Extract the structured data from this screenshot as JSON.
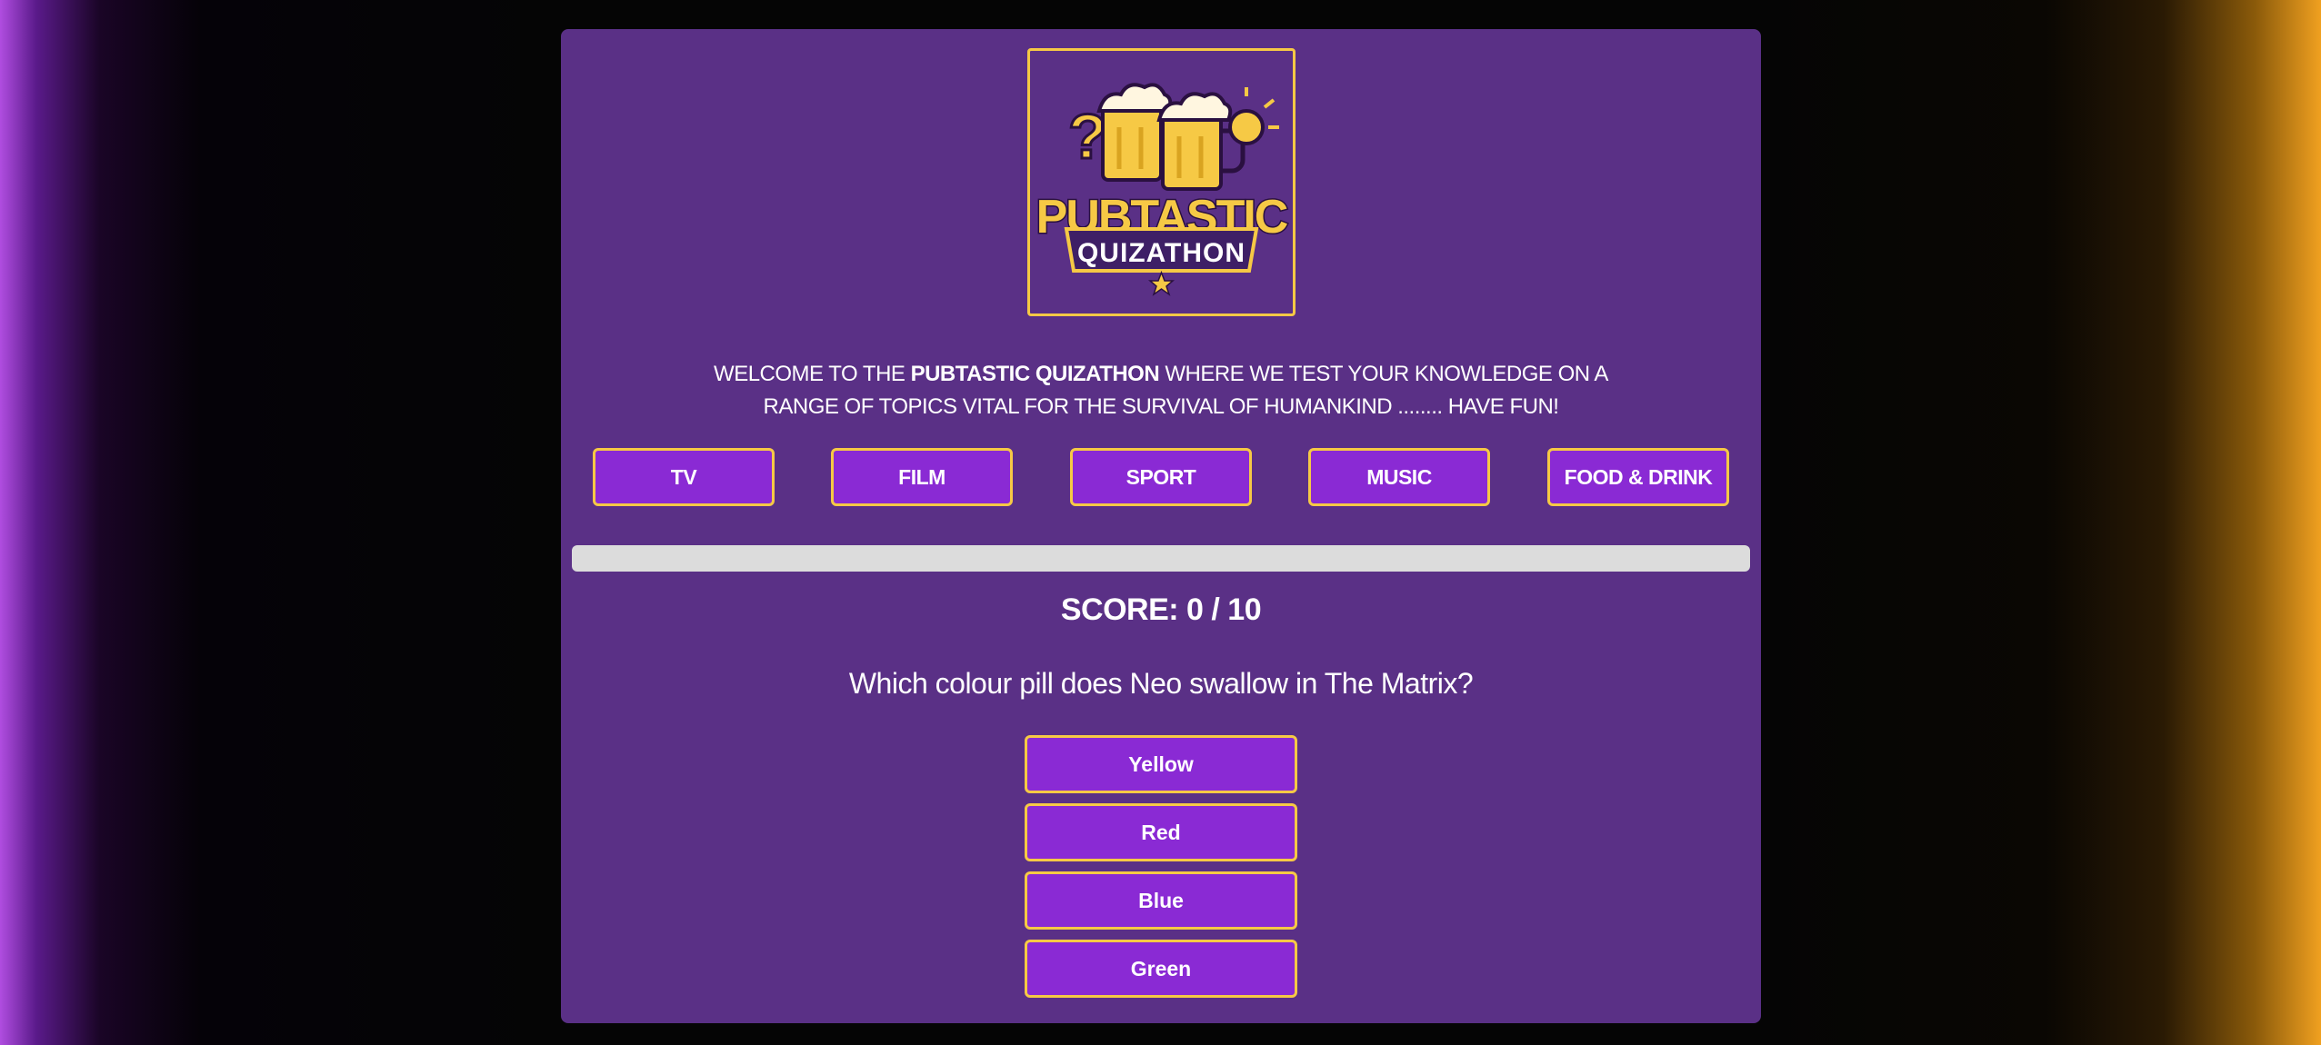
{
  "logo": {
    "line1": "PUBTASTIC",
    "line2": "QUIZATHON",
    "question_mark": "?",
    "icon": "beer-mugs-lightbulb-logo"
  },
  "welcome": {
    "prefix": "WELCOME TO THE ",
    "brand": "PUBTASTIC QUIZATHON",
    "suffix": " WHERE WE TEST YOUR KNOWLEDGE ON A",
    "line2": "RANGE OF TOPICS VITAL FOR THE SURVIVAL OF HUMANKIND ........ HAVE FUN!"
  },
  "categories": [
    {
      "label": "TV"
    },
    {
      "label": "FILM"
    },
    {
      "label": "SPORT"
    },
    {
      "label": "MUSIC"
    },
    {
      "label": "FOOD & DRINK"
    }
  ],
  "progress": {
    "value": 0
  },
  "score": {
    "text": "SCORE: 0 / 10"
  },
  "question": {
    "text": "Which colour pill does Neo swallow in The Matrix?"
  },
  "answers": [
    {
      "label": "Yellow"
    },
    {
      "label": "Red"
    },
    {
      "label": "Blue"
    },
    {
      "label": "Green"
    }
  ],
  "colors": {
    "card": "#5a3086",
    "button": "#8a2ad4",
    "accent_gold": "#f6c945",
    "progress_track": "#dcdcdc"
  }
}
